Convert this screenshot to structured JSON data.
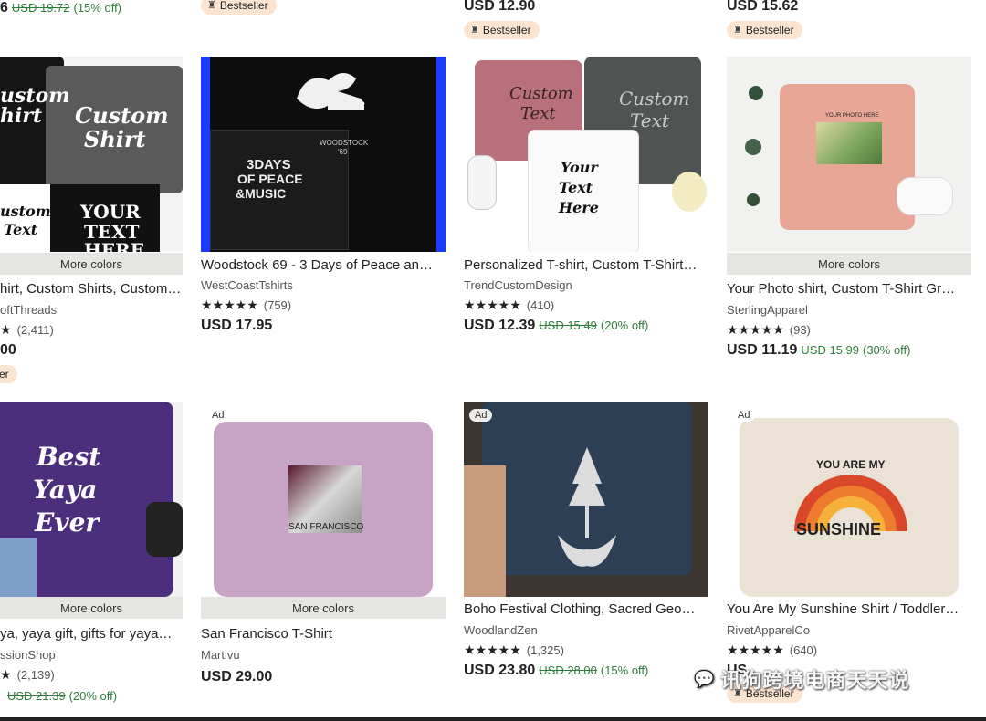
{
  "top_row": {
    "col1": {
      "price_partial": "6",
      "orig_price": "USD 19.72",
      "discount": "(15% off)"
    },
    "col2": {
      "badge": "Bestseller"
    },
    "col3": {
      "price": "USD 12.90",
      "badge": "Bestseller"
    },
    "col4": {
      "price": "USD 15.62",
      "badge": "Bestseller"
    }
  },
  "row1": [
    {
      "image_text": [
        "ustom",
        "hirt",
        "Custom",
        "Shirt",
        "ustom",
        "Text",
        "YOUR",
        "TEXT",
        "HERE"
      ],
      "more_colors": "More colors",
      "title": "hirt, Custom Shirts, Custom…",
      "shop": "oftThreads",
      "reviews": "(2,411)",
      "price_partial": "00",
      "badge_partial": "er"
    },
    {
      "image_text": [
        "3DAYS",
        "OF PEACE",
        "&MUSIC",
        "WOODSTOCK",
        "'69"
      ],
      "title": "Woodstock 69 - 3 Days of Peace an…",
      "shop": "WestCoastTshirts",
      "stars": "★★★★★",
      "reviews": "(759)",
      "price": "USD 17.95"
    },
    {
      "image_text": [
        "Custom",
        "Text",
        "Custom",
        "Text",
        "Your",
        "Text",
        "Here"
      ],
      "title": "Personalized T-shirt, Custom T-Shirt…",
      "shop": "TrendCustomDesign",
      "stars": "★★★★★",
      "reviews": "(410)",
      "price": "USD 12.39",
      "orig_price": "USD 15.49",
      "discount": "(20% off)"
    },
    {
      "image_text": [
        "YOUR PHOTO HERE"
      ],
      "more_colors": "More colors",
      "title": "Your Photo shirt, Custom T-Shirt Gr…",
      "shop": "SterlingApparel",
      "stars": "★★★★★",
      "reviews": "(93)",
      "price": "USD 11.19",
      "orig_price": "USD 15.99",
      "discount": "(30% off)"
    }
  ],
  "row2": [
    {
      "image_text": [
        "Best",
        "Yaya",
        "Ever"
      ],
      "more_colors": "More colors",
      "title": "ya, yaya gift, gifts for yaya…",
      "shop": "ssionShop",
      "reviews": "(2,139)",
      "orig_price": "USD 21.39",
      "discount": "(20% off)"
    },
    {
      "ad": "Ad",
      "image_text": [
        "SAN FRANCISCO"
      ],
      "more_colors": "More colors",
      "title": "San Francisco T-Shirt",
      "shop": "Martivu",
      "price": "USD 29.00"
    },
    {
      "ad": "Ad",
      "title": "Boho Festival Clothing, Sacred Geo…",
      "shop": "WoodlandZen",
      "stars": "★★★★★",
      "reviews": "(1,325)",
      "price": "USD 23.80",
      "orig_price": "USD 28.00",
      "discount": "(15% off)"
    },
    {
      "ad": "Ad",
      "image_text": [
        "YOU ARE MY",
        "SUNSHINE"
      ],
      "title": "You Are My Sunshine Shirt / Toddler…",
      "shop": "RivetApparelCo",
      "stars": "★★★★★",
      "reviews": "(640)",
      "price_partial": "US",
      "badge": "Bestseller"
    }
  ],
  "watermark": "讯狗跨境电商天天说",
  "colors": {
    "discount_green": "#2f7d3b",
    "badge_bg": "#fbe4d2",
    "more_colors_bg": "#e5e6e2"
  }
}
